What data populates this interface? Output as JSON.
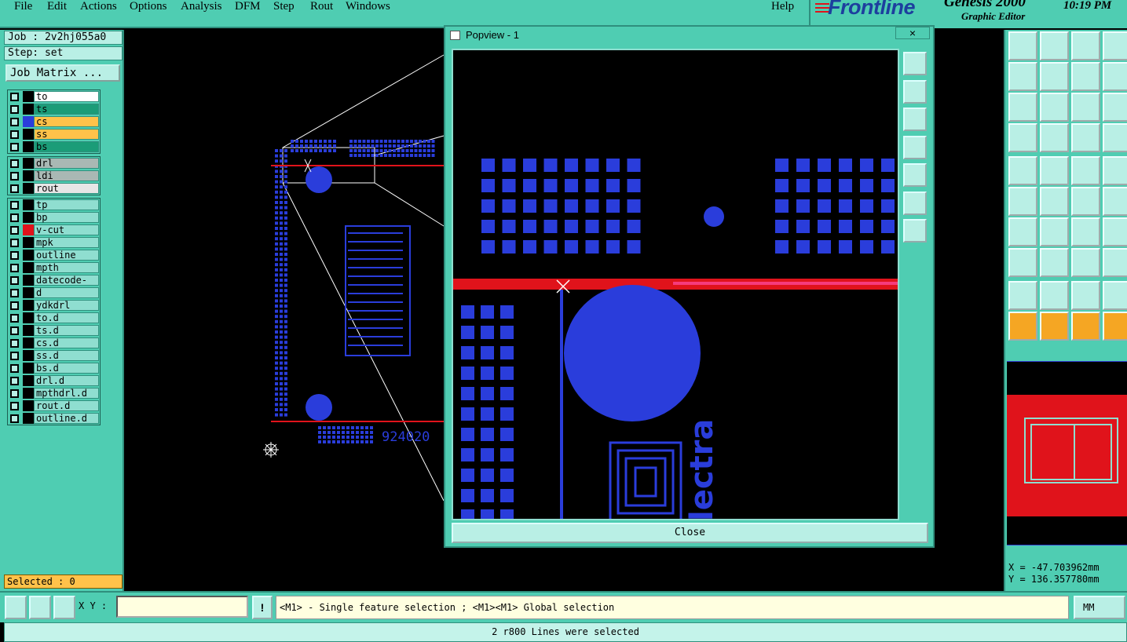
{
  "menu": {
    "file": "File",
    "edit": "Edit",
    "actions": "Actions",
    "options": "Options",
    "analysis": "Analysis",
    "dfm": "DFM",
    "step": "Step",
    "rout": "Rout",
    "windows": "Windows",
    "help": "Help"
  },
  "brand": {
    "logo": "Frontline",
    "product": "Genesis 2000",
    "subtitle": "Graphic Editor",
    "time": "10:19 PM"
  },
  "job": {
    "job_label": "Job : 2v2hj055a0",
    "step_label": "Step: set",
    "matrix_button": "Job Matrix ..."
  },
  "layers": {
    "group1": [
      {
        "name": "to",
        "color": "#ffffff",
        "swatch": "#000000"
      },
      {
        "name": "ts",
        "color": "#1b9c78",
        "swatch": "#000000"
      },
      {
        "name": "cs",
        "color": "#ffc24a",
        "swatch": "#2a3ddb"
      },
      {
        "name": "ss",
        "color": "#ffc24a",
        "swatch": "#000000"
      },
      {
        "name": "bs",
        "color": "#1b9c78",
        "swatch": "#000000"
      }
    ],
    "group2": [
      {
        "name": "drl",
        "color": "#a9b8b4",
        "swatch": "#000000"
      },
      {
        "name": "ldi",
        "color": "#a9b8b4",
        "swatch": "#000000"
      },
      {
        "name": "rout",
        "color": "#e6e6e6",
        "swatch": "#000000"
      }
    ],
    "group3": [
      {
        "name": "tp",
        "color": "#8fded0",
        "swatch": "#000000"
      },
      {
        "name": "bp",
        "color": "#8fded0",
        "swatch": "#000000"
      },
      {
        "name": "v-cut",
        "color": "#8fded0",
        "swatch": "#e0131b"
      },
      {
        "name": "mpk",
        "color": "#8fded0",
        "swatch": "#000000"
      },
      {
        "name": "outline",
        "color": "#8fded0",
        "swatch": "#000000"
      },
      {
        "name": "mpth",
        "color": "#8fded0",
        "swatch": "#000000"
      },
      {
        "name": "datecode-cs",
        "color": "#8fded0",
        "swatch": "#000000"
      },
      {
        "name": "d",
        "color": "#8fded0",
        "swatch": "#000000"
      },
      {
        "name": "ydkdrl",
        "color": "#8fded0",
        "swatch": "#000000"
      },
      {
        "name": "to.d",
        "color": "#8fded0",
        "swatch": "#000000"
      },
      {
        "name": "ts.d",
        "color": "#8fded0",
        "swatch": "#000000"
      },
      {
        "name": "cs.d",
        "color": "#8fded0",
        "swatch": "#000000"
      },
      {
        "name": "ss.d",
        "color": "#8fded0",
        "swatch": "#000000"
      },
      {
        "name": "bs.d",
        "color": "#8fded0",
        "swatch": "#000000"
      },
      {
        "name": "drl.d",
        "color": "#8fded0",
        "swatch": "#000000"
      },
      {
        "name": "mpthdrl.d",
        "color": "#8fded0",
        "swatch": "#000000"
      },
      {
        "name": "rout.d",
        "color": "#8fded0",
        "swatch": "#000000"
      },
      {
        "name": "outline.d",
        "color": "#8fded0",
        "swatch": "#000000"
      }
    ]
  },
  "selected": "Selected : 0",
  "board_text": "924020",
  "popview": {
    "title": "Popview - 1",
    "close_x": "×",
    "close_button": "Close",
    "silk_text": "lectra"
  },
  "coords": {
    "x": "X = -47.703962mm",
    "y": "Y = 136.357780mm"
  },
  "bottom": {
    "xy_label": "X Y :",
    "xy_value": "",
    "bang": "!",
    "prompt": "<M1> - Single feature selection ; <M1><M1> Global selection",
    "unit": "MM"
  },
  "status": "2 r800 Lines were selected",
  "colors": {
    "panel": "#4fcdb2",
    "pad": "#2a3ddb",
    "vcut": "#e0131b"
  }
}
